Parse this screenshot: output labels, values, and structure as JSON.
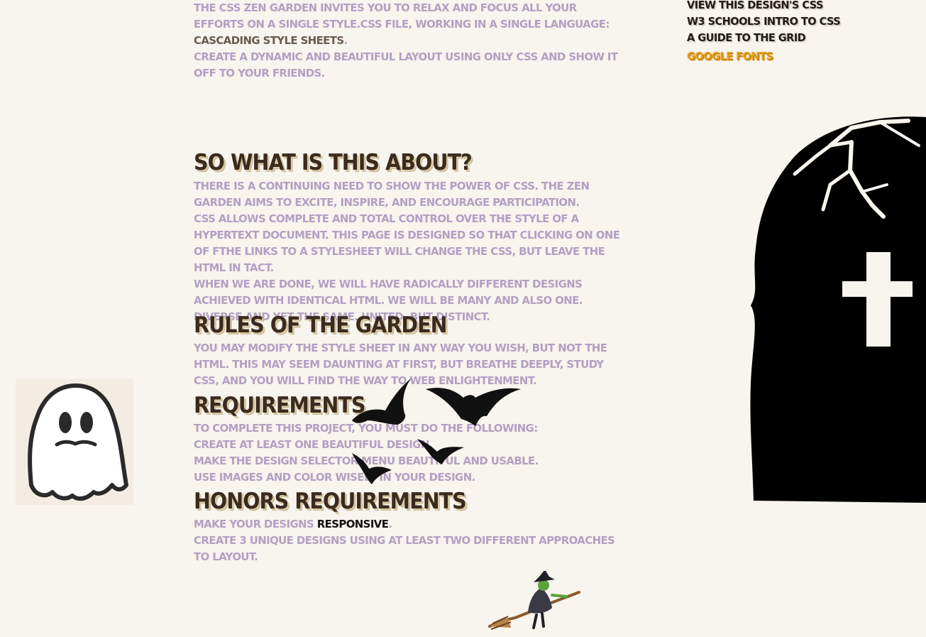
{
  "intro": {
    "line1": "The CSS Zen Garden invites you to relax and focus all your efforts on a single style.css file, working in a single language: ",
    "link": "Cascading Style Sheets",
    "line1_end": ".",
    "line2": "Create a dynamic and beautiful layout using only CSS and show it off to your friends."
  },
  "about": {
    "heading": "So what is this about?",
    "p1": "There is a continuing need to show the power of CSS. The Zen Garden aims to excite, inspire, and encourage participation.",
    "p2": "CSS allows complete and total control over the style of a hypertext document. This page is designed so that clicking on one of ftHe links to a stylesheet will change the CSS, but leave the HTML in tact.",
    "p3": "When we are done, we will have radically different designs achieved with identical HTML. We will be many and also one. Diverse and yet the same. United, but distinct."
  },
  "rules": {
    "heading": "Rules of the Garden",
    "p1": "You may modify the style sheet in any way you wish, but not the HTML. This may seem daunting at first, but breathe deeply, study CSS, and you will find the way to web enlightenment."
  },
  "requirements": {
    "heading": "Requirements",
    "intro": "To complete this project, you must do the following:",
    "items": [
      "Create at least one beautiful design.",
      "Make the design selector menu beautiful and usable.",
      "Use images and color wisely in your design."
    ]
  },
  "honors": {
    "heading": "Honors Requirements",
    "item1_pre": "Make your designs ",
    "item1_link": "responsive",
    "item1_post": ".",
    "item2": "Create 3 unique designs using at least two different approaches to layout."
  },
  "sidebar": {
    "links": [
      "View This Design's CSS",
      "W3 Schools Intro to CSS",
      "A Guide to the Grid",
      "Google Fonts"
    ]
  },
  "images": {
    "ghost": "ghost-icon",
    "tombstone": "tombstone-icon",
    "bats": "bat-icon",
    "witch": "witch-on-broom-icon"
  },
  "colors": {
    "background": "#f8f4ee",
    "body_text": "#b3a0c3",
    "heading": "#3b2b1e",
    "accent_link": "#e3a11f",
    "inline_link": "#6b5a4e"
  }
}
